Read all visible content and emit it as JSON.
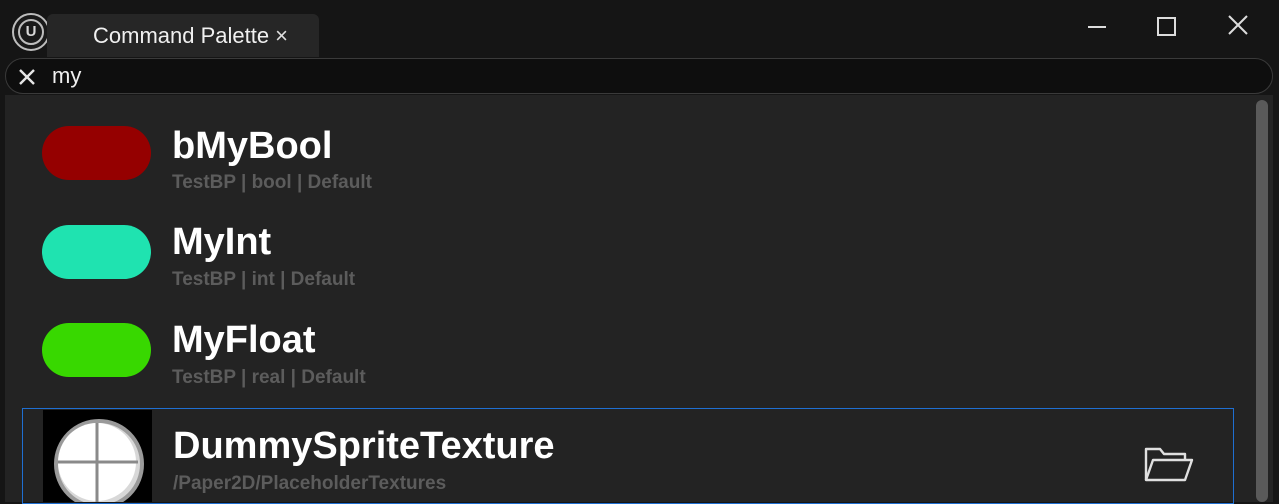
{
  "window": {
    "tab_title": "Command Palette",
    "tab_close_glyph": "×",
    "icons": {
      "logo": "unreal-engine-logo-icon",
      "minimize": "minimize-icon",
      "maximize": "maximize-icon",
      "close": "close-icon",
      "logo_glyph": "U"
    }
  },
  "search": {
    "value": "my",
    "clear_icon": "clear-icon"
  },
  "colors": {
    "bool": "#950000",
    "int": "#1fe3b0",
    "float": "#38d800",
    "selection_border": "#1f6fd1"
  },
  "results": [
    {
      "title": "bMyBool",
      "subtitle": "TestBP | bool | Default",
      "icon": "bool-pin-icon"
    },
    {
      "title": "MyInt",
      "subtitle": "TestBP | int | Default",
      "icon": "int-pin-icon"
    },
    {
      "title": "MyFloat",
      "subtitle": "TestBP | real | Default",
      "icon": "float-pin-icon"
    },
    {
      "title": "DummySpriteTexture",
      "subtitle": "/Paper2D/PlaceholderTextures",
      "icon": "texture-thumbnail-icon",
      "action_icon": "open-folder-icon",
      "selected": true
    }
  ]
}
